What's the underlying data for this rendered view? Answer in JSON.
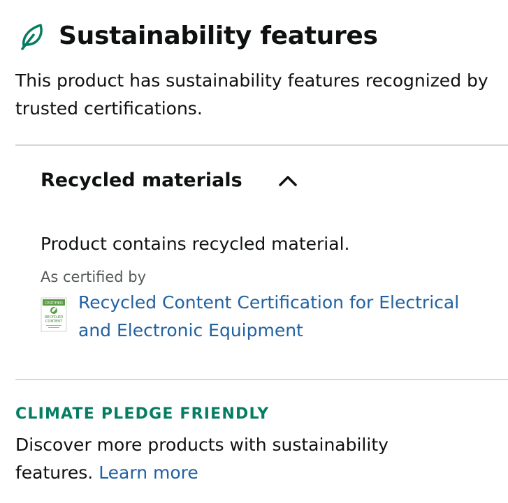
{
  "header": {
    "icon": "leaf-icon",
    "title": "Sustainability features"
  },
  "intro": "This product has sustainability features recognized by trusted certifications.",
  "section": {
    "title": "Recycled materials",
    "toggle_icon": "chevron-up-icon",
    "description": "Product contains recycled material.",
    "certified_by_label": "As certified by",
    "certification": {
      "badge_icon": "recycled-content-certified-badge",
      "badge_text": [
        "CERTIFIED",
        "RECYCLED",
        "CONTENT"
      ],
      "link_text": "Recycled Content Certification for Electrical and Electronic Equipment"
    }
  },
  "footer": {
    "brand": "CLIMATE PLEDGE FRIENDLY",
    "discover_text": "Discover more products with sustainability features.",
    "learn_more": "Learn more"
  },
  "colors": {
    "text": "#0f1111",
    "link": "#2162a1",
    "brand_green": "#067d62",
    "leaf_green": "#067d62",
    "muted": "#565959",
    "divider": "#d5d9d9"
  }
}
